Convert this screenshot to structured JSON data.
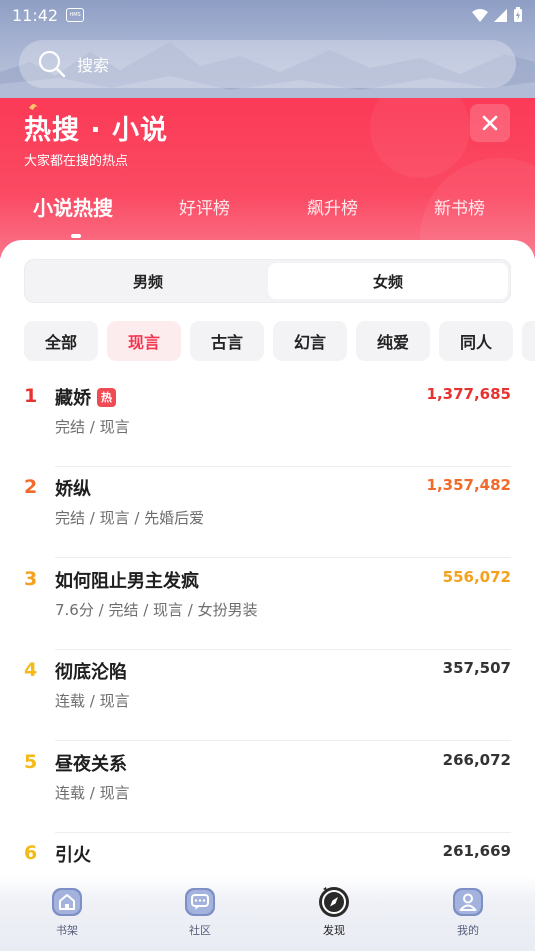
{
  "status_bar": {
    "time": "11:42",
    "badge": "HMS"
  },
  "search": {
    "placeholder": "搜索"
  },
  "hot": {
    "title": "热搜 · 小说",
    "subtitle": "大家都在搜的热点",
    "tabs": [
      "小说热搜",
      "好评榜",
      "飙升榜",
      "新书榜"
    ],
    "active_tab": "小说热搜"
  },
  "gender": {
    "options": [
      "男频",
      "女频"
    ],
    "selected": "女频"
  },
  "categories": {
    "items": [
      "全部",
      "现言",
      "古言",
      "幻言",
      "纯爱",
      "同人"
    ],
    "selected": "现言"
  },
  "books": [
    {
      "rank": "1",
      "title": "藏娇",
      "tag": "热",
      "meta": "完结 / 现言",
      "score": "1,377,685"
    },
    {
      "rank": "2",
      "title": "娇纵",
      "tag": "",
      "meta": "完结 / 现言 / 先婚后爱",
      "score": "1,357,482"
    },
    {
      "rank": "3",
      "title": "如何阻止男主发疯",
      "tag": "",
      "meta": "7.6分 / 完结 / 现言 / 女扮男装",
      "score": "556,072"
    },
    {
      "rank": "4",
      "title": "彻底沦陷",
      "tag": "",
      "meta": "连载 / 现言",
      "score": "357,507"
    },
    {
      "rank": "5",
      "title": "昼夜关系",
      "tag": "",
      "meta": "连载 / 现言",
      "score": "266,072"
    },
    {
      "rank": "6",
      "title": "引火",
      "tag": "",
      "meta": "",
      "score": "261,669"
    }
  ],
  "colors": {
    "accent": "#f2364f",
    "rank1": "#e8322f",
    "rank2": "#f26a2a",
    "rank3": "#f5a11d",
    "rank_rest": "#f5b918",
    "score_top": "#e8322f",
    "score_2": "#f26a2a",
    "score_3": "#f5a11d",
    "score_rest": "#333333"
  },
  "bottom_nav": {
    "items": [
      {
        "label": "书架",
        "icon": "home-icon"
      },
      {
        "label": "社区",
        "icon": "chat-icon"
      },
      {
        "label": "发现",
        "icon": "compass-icon"
      },
      {
        "label": "我的",
        "icon": "user-icon"
      }
    ],
    "selected": "发现"
  }
}
